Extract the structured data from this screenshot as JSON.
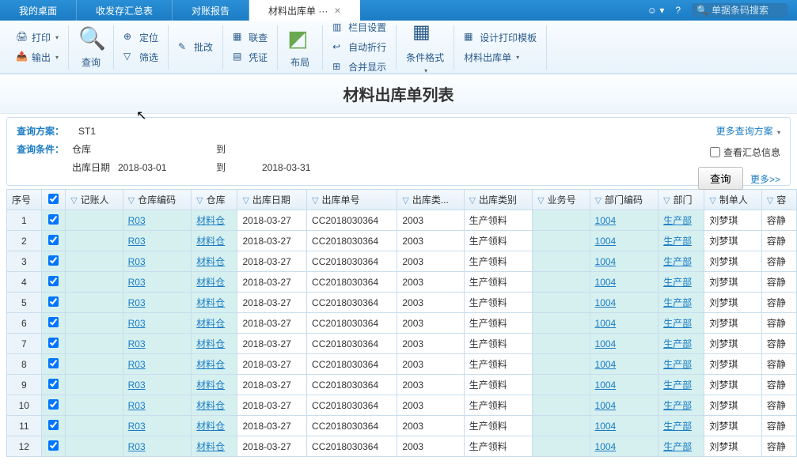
{
  "tabs": {
    "items": [
      {
        "label": "我的桌面"
      },
      {
        "label": "收发存汇总表"
      },
      {
        "label": "对账报告"
      },
      {
        "label": "材料出库单 ···",
        "active": true
      }
    ],
    "search_placeholder": "单据条码搜索"
  },
  "ribbon": {
    "print": "打印",
    "output": "输出",
    "query": "查询",
    "locate": "定位",
    "filter": "筛选",
    "batch": "批改",
    "link": "联查",
    "voucher": "凭证",
    "layout": "布局",
    "column_set": "栏目设置",
    "auto_wrap": "自动折行",
    "merge_show": "合并显示",
    "cond_fmt": "条件格式",
    "design_tpl": "设计打印模板",
    "out_list": "材料出库单"
  },
  "title": "材料出库单列表",
  "query": {
    "scheme_label": "查询方案：",
    "scheme_value": "ST1",
    "cond_label": "查询条件：",
    "warehouse_label": "仓库",
    "to_label": "到",
    "date_label": "出库日期",
    "date_from": "2018-03-01",
    "date_to": "2018-03-31",
    "more_scheme": "更多查询方案",
    "summary_check": "查看汇总信息",
    "query_btn": "查询",
    "more_link": "更多>>"
  },
  "table": {
    "headers": {
      "seq": "序号",
      "poster": "记账人",
      "wh_code": "仓库编码",
      "wh": "仓库",
      "out_date": "出库日期",
      "out_no": "出库单号",
      "out_class": "出库类...",
      "out_type": "出库类别",
      "biz_no": "业务号",
      "dept_code": "部门编码",
      "dept": "部门",
      "maker": "制单人",
      "last": "容"
    },
    "rows": [
      {
        "seq": 1,
        "wh_code": "R03",
        "wh": "材料仓",
        "date": "2018-03-27",
        "no": "CC2018030364",
        "cls": "2003",
        "type": "生产领料",
        "dept_code": "1004",
        "dept": "生产部",
        "maker": "刘梦琪",
        "last": "容静"
      },
      {
        "seq": 2,
        "wh_code": "R03",
        "wh": "材料仓",
        "date": "2018-03-27",
        "no": "CC2018030364",
        "cls": "2003",
        "type": "生产领料",
        "dept_code": "1004",
        "dept": "生产部",
        "maker": "刘梦琪",
        "last": "容静"
      },
      {
        "seq": 3,
        "wh_code": "R03",
        "wh": "材料仓",
        "date": "2018-03-27",
        "no": "CC2018030364",
        "cls": "2003",
        "type": "生产领料",
        "dept_code": "1004",
        "dept": "生产部",
        "maker": "刘梦琪",
        "last": "容静"
      },
      {
        "seq": 4,
        "wh_code": "R03",
        "wh": "材料仓",
        "date": "2018-03-27",
        "no": "CC2018030364",
        "cls": "2003",
        "type": "生产领料",
        "dept_code": "1004",
        "dept": "生产部",
        "maker": "刘梦琪",
        "last": "容静"
      },
      {
        "seq": 5,
        "wh_code": "R03",
        "wh": "材料仓",
        "date": "2018-03-27",
        "no": "CC2018030364",
        "cls": "2003",
        "type": "生产领料",
        "dept_code": "1004",
        "dept": "生产部",
        "maker": "刘梦琪",
        "last": "容静"
      },
      {
        "seq": 6,
        "wh_code": "R03",
        "wh": "材料仓",
        "date": "2018-03-27",
        "no": "CC2018030364",
        "cls": "2003",
        "type": "生产领料",
        "dept_code": "1004",
        "dept": "生产部",
        "maker": "刘梦琪",
        "last": "容静"
      },
      {
        "seq": 7,
        "wh_code": "R03",
        "wh": "材料仓",
        "date": "2018-03-27",
        "no": "CC2018030364",
        "cls": "2003",
        "type": "生产领料",
        "dept_code": "1004",
        "dept": "生产部",
        "maker": "刘梦琪",
        "last": "容静"
      },
      {
        "seq": 8,
        "wh_code": "R03",
        "wh": "材料仓",
        "date": "2018-03-27",
        "no": "CC2018030364",
        "cls": "2003",
        "type": "生产领料",
        "dept_code": "1004",
        "dept": "生产部",
        "maker": "刘梦琪",
        "last": "容静"
      },
      {
        "seq": 9,
        "wh_code": "R03",
        "wh": "材料仓",
        "date": "2018-03-27",
        "no": "CC2018030364",
        "cls": "2003",
        "type": "生产领料",
        "dept_code": "1004",
        "dept": "生产部",
        "maker": "刘梦琪",
        "last": "容静"
      },
      {
        "seq": 10,
        "wh_code": "R03",
        "wh": "材料仓",
        "date": "2018-03-27",
        "no": "CC2018030364",
        "cls": "2003",
        "type": "生产领料",
        "dept_code": "1004",
        "dept": "生产部",
        "maker": "刘梦琪",
        "last": "容静"
      },
      {
        "seq": 11,
        "wh_code": "R03",
        "wh": "材料仓",
        "date": "2018-03-27",
        "no": "CC2018030364",
        "cls": "2003",
        "type": "生产领料",
        "dept_code": "1004",
        "dept": "生产部",
        "maker": "刘梦琪",
        "last": "容静"
      },
      {
        "seq": 12,
        "wh_code": "R03",
        "wh": "材料仓",
        "date": "2018-03-27",
        "no": "CC2018030364",
        "cls": "2003",
        "type": "生产领料",
        "dept_code": "1004",
        "dept": "生产部",
        "maker": "刘梦琪",
        "last": "容静"
      }
    ]
  }
}
